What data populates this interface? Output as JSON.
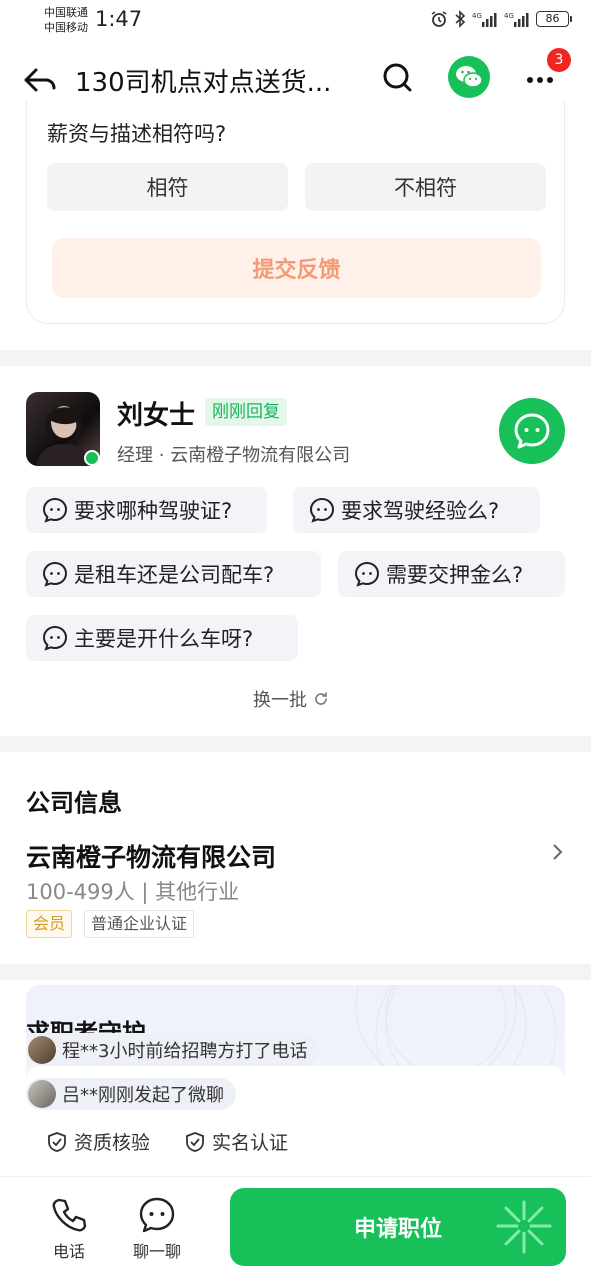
{
  "status_bar": {
    "carrier1": "中国联通",
    "carrier2": "中国移动",
    "time": "1:47",
    "battery": "86"
  },
  "header": {
    "title": "130司机点对点送货...",
    "badge_count": "3"
  },
  "feedback": {
    "question": "薪资与描述相符吗?",
    "option_yes": "相符",
    "option_no": "不相符",
    "submit": "提交反馈"
  },
  "recruiter": {
    "name": "刘女士",
    "reply_tag": "刚刚回复",
    "title": "经理",
    "company": "云南橙子物流有限公司"
  },
  "questions": [
    "要求哪种驾驶证?",
    "要求驾驶经验么?",
    "是租车还是公司配车?",
    "需要交押金么?",
    "主要是开什么车呀?"
  ],
  "refresh_label": "换一批",
  "company": {
    "section_title": "公司信息",
    "name": "云南橙子物流有限公司",
    "meta": "100-499人 | 其他行业",
    "tag_member": "会员",
    "tag_cert": "普通企业认证"
  },
  "protection": {
    "title": "求职者守护",
    "notice1": "程**3小时前给招聘方打了电话",
    "notice2": "吕**刚刚发起了微聊",
    "badge1": "资质核验",
    "badge2": "实名认证"
  },
  "bottom": {
    "phone": "电话",
    "chat": "聊一聊",
    "apply": "申请职位"
  },
  "colors": {
    "brand_green": "#18c05a",
    "badge_red": "#f0261f",
    "submit_text": "#f39a77"
  }
}
